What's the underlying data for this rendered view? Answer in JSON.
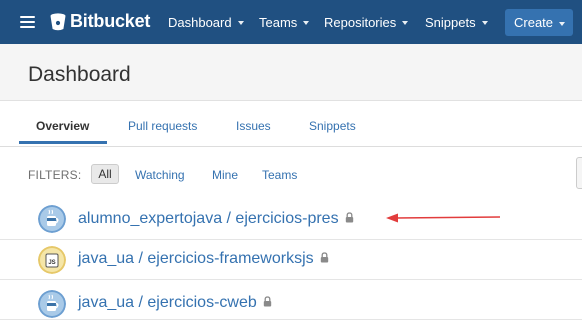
{
  "topbar": {
    "logo_text": "Bitbucket",
    "nav": [
      {
        "label": "Dashboard"
      },
      {
        "label": "Teams"
      },
      {
        "label": "Repositories"
      },
      {
        "label": "Snippets"
      }
    ],
    "create_label": "Create",
    "brand_color": "#205081"
  },
  "header": {
    "title": "Dashboard"
  },
  "tabs": [
    {
      "label": "Overview",
      "active": true
    },
    {
      "label": "Pull requests"
    },
    {
      "label": "Issues"
    },
    {
      "label": "Snippets"
    }
  ],
  "filters": {
    "label": "FILTERS:",
    "options": [
      {
        "label": "All",
        "selected": true
      },
      {
        "label": "Watching"
      },
      {
        "label": "Mine"
      },
      {
        "label": "Teams"
      }
    ]
  },
  "repositories": [
    {
      "name": "alumno_expertojava / ejercicios-pres",
      "private": true,
      "avatar": "coffee-cup-icon",
      "highlighted_by_arrow": true
    },
    {
      "name": "java_ua / ejercicios-frameworksjs",
      "private": true,
      "avatar": "js-icon"
    },
    {
      "name": "java_ua / ejercicios-cweb",
      "private": true,
      "avatar": "coffee-cup-icon"
    }
  ],
  "annotation_color": "#e23c3c",
  "avatar_labels": {
    "js": "JS"
  }
}
